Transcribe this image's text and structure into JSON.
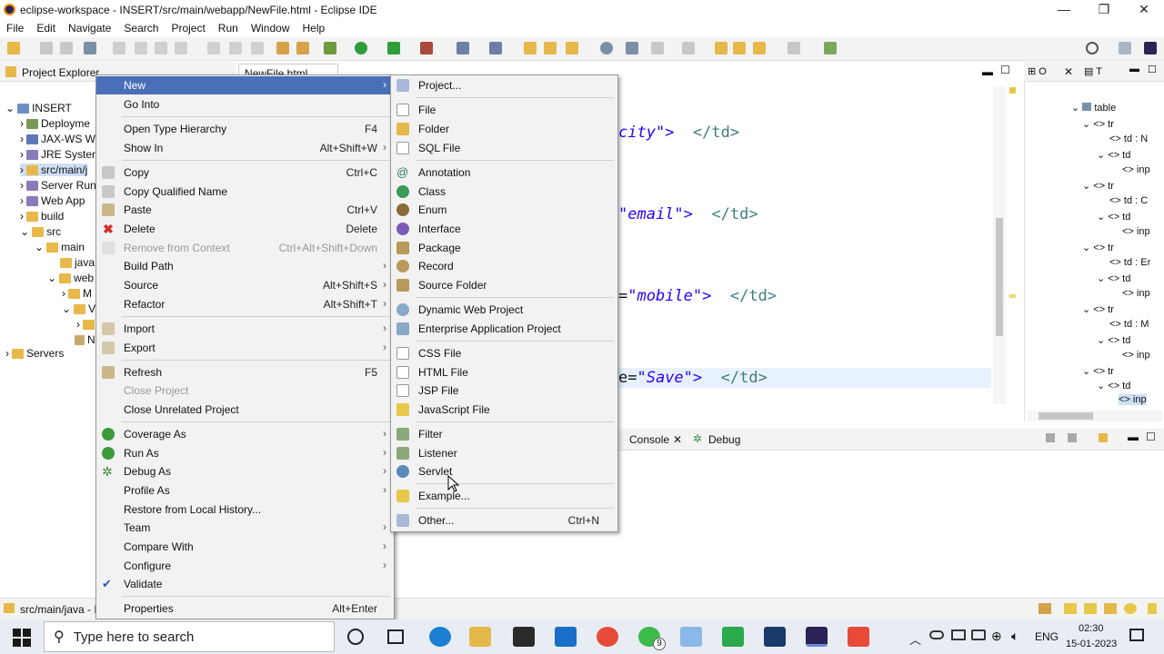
{
  "window": {
    "title": "eclipse-workspace - INSERT/src/main/webapp/NewFile.html - Eclipse IDE",
    "minimize": "—",
    "maximize": "❐",
    "close": "✕"
  },
  "menubar": [
    "File",
    "Edit",
    "Navigate",
    "Search",
    "Project",
    "Run",
    "Window",
    "Help"
  ],
  "project_explorer": {
    "title": "Project Explorer",
    "items": [
      {
        "label": "INSERT"
      },
      {
        "label": "Deployme"
      },
      {
        "label": "JAX-WS W"
      },
      {
        "label": "JRE Systen"
      },
      {
        "label": "src/main/j"
      },
      {
        "label": "Server Run"
      },
      {
        "label": "Web App"
      },
      {
        "label": "build"
      },
      {
        "label": "src"
      },
      {
        "label": "main"
      },
      {
        "label": "java"
      },
      {
        "label": "web"
      },
      {
        "label": "M"
      },
      {
        "label": "V"
      },
      {
        "label": "N"
      },
      {
        "label": "Servers"
      }
    ]
  },
  "editor": {
    "tab_label": "NewFile.html",
    "lines": [
      {
        "str": "city\">",
        "tag": "</td>"
      },
      {
        "str": "\"email\">",
        "tag": "</td>"
      },
      {
        "eq": "=",
        "str": "\"mobile\">",
        "tag": "</td>"
      },
      {
        "eq": "e=",
        "str": "\"Save\">",
        "tag": "</td>"
      }
    ]
  },
  "outline": {
    "items": [
      "table",
      "<> tr",
      "<> td : N",
      "<> td",
      "<> inp",
      "<> tr",
      "<> td : C",
      "<> td",
      "<> inp",
      "<> tr",
      "<> td : Er",
      "<> td",
      "<> inp",
      "<> tr",
      "<> td : M",
      "<> td",
      "<> inp",
      "<> tr",
      "<> td",
      "<> inp"
    ]
  },
  "console_tabs": {
    "console": "Console",
    "debug": "Debug"
  },
  "statusbar": {
    "text": "src/main/java - I"
  },
  "context_menu": {
    "items": [
      {
        "label": "New",
        "shortcut": "",
        "submenu": true
      },
      {
        "label": "Go Into",
        "shortcut": ""
      },
      {
        "label": "Open Type Hierarchy",
        "shortcut": "F4"
      },
      {
        "label": "Show In",
        "shortcut": "Alt+Shift+W",
        "submenu": true
      },
      {
        "label": "Copy",
        "shortcut": "Ctrl+C"
      },
      {
        "label": "Copy Qualified Name",
        "shortcut": ""
      },
      {
        "label": "Paste",
        "shortcut": "Ctrl+V"
      },
      {
        "label": "Delete",
        "shortcut": "Delete"
      },
      {
        "label": "Remove from Context",
        "shortcut": "Ctrl+Alt+Shift+Down"
      },
      {
        "label": "Build Path",
        "shortcut": "",
        "submenu": true
      },
      {
        "label": "Source",
        "shortcut": "Alt+Shift+S",
        "submenu": true
      },
      {
        "label": "Refactor",
        "shortcut": "Alt+Shift+T",
        "submenu": true
      },
      {
        "label": "Import",
        "shortcut": "",
        "submenu": true
      },
      {
        "label": "Export",
        "shortcut": "",
        "submenu": true
      },
      {
        "label": "Refresh",
        "shortcut": "F5"
      },
      {
        "label": "Close Project",
        "shortcut": ""
      },
      {
        "label": "Close Unrelated Project",
        "shortcut": ""
      },
      {
        "label": "Coverage As",
        "shortcut": "",
        "submenu": true
      },
      {
        "label": "Run As",
        "shortcut": "",
        "submenu": true
      },
      {
        "label": "Debug As",
        "shortcut": "",
        "submenu": true
      },
      {
        "label": "Profile As",
        "shortcut": "",
        "submenu": true
      },
      {
        "label": "Restore from Local History...",
        "shortcut": ""
      },
      {
        "label": "Team",
        "shortcut": "",
        "submenu": true
      },
      {
        "label": "Compare With",
        "shortcut": "",
        "submenu": true
      },
      {
        "label": "Configure",
        "shortcut": "",
        "submenu": true
      },
      {
        "label": "Validate",
        "shortcut": ""
      },
      {
        "label": "Properties",
        "shortcut": "Alt+Enter"
      }
    ]
  },
  "new_submenu": {
    "items": [
      {
        "label": "Project..."
      },
      {
        "label": "File"
      },
      {
        "label": "Folder"
      },
      {
        "label": "SQL File"
      },
      {
        "label": "Annotation"
      },
      {
        "label": "Class"
      },
      {
        "label": "Enum"
      },
      {
        "label": "Interface"
      },
      {
        "label": "Package"
      },
      {
        "label": "Record"
      },
      {
        "label": "Source Folder"
      },
      {
        "label": "Dynamic Web Project"
      },
      {
        "label": "Enterprise Application Project"
      },
      {
        "label": "CSS File"
      },
      {
        "label": "HTML File"
      },
      {
        "label": "JSP File"
      },
      {
        "label": "JavaScript File"
      },
      {
        "label": "Filter"
      },
      {
        "label": "Listener"
      },
      {
        "label": "Servlet"
      },
      {
        "label": "Example..."
      },
      {
        "label": "Other...",
        "shortcut": "Ctrl+N"
      }
    ]
  },
  "taskbar": {
    "search_placeholder": "Type here to search",
    "time": "02:30",
    "date": "15-01-2023",
    "lang": "ENG",
    "whatsapp_badge": "9"
  },
  "colors": {
    "menu_highlight": "#4a6fb8",
    "string": "#2a00ff",
    "tag": "#3f7f7f"
  }
}
